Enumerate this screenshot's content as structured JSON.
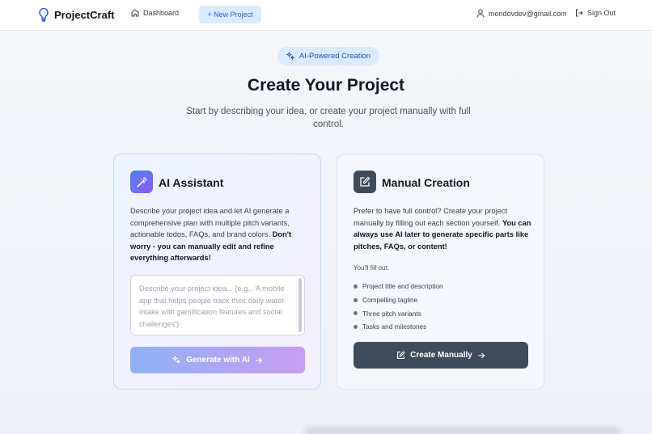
{
  "header": {
    "brand": "ProjectCraft",
    "nav_dashboard": "Dashboard",
    "nav_new_project": "+ New Project",
    "user_email": "mondovdev@gmail.com",
    "sign_out": "Sign Out"
  },
  "hero": {
    "badge": "AI-Powered Creation",
    "title": "Create Your Project",
    "subtitle": "Start by describing your idea, or create your project manually with full control."
  },
  "ai_card": {
    "title": "AI Assistant",
    "desc_plain": "Describe your project idea and let AI generate a comprehensive plan with multiple pitch variants, actionable todos, FAQs, and brand colors. ",
    "desc_bold": "Don't worry - you can manually edit and refine everything afterwards!",
    "textarea_placeholder": "Describe your project idea... (e.g., 'A mobile app that helps people track their daily water intake with gamification features and social challenges')",
    "button_label": "Generate with AI",
    "accent_start": "#8fb1f5",
    "accent_end": "#c89df2"
  },
  "manual_card": {
    "title": "Manual Creation",
    "desc_plain": "Prefer to have full control? Create your project manually by filling out each section yourself. ",
    "desc_bold": "You can always use AI later to generate specific parts like pitches, FAQs, or content!",
    "fill_label": "You'll fill out:",
    "fill_items": [
      "Project title and description",
      "Compelling tagline",
      "Three pitch variants",
      "Tasks and milestones"
    ],
    "button_label": "Create Manually",
    "button_color": "#3f4a5a"
  },
  "icons": {
    "brand": "lightbulb-icon",
    "dashboard": "home-icon",
    "user": "user-icon",
    "sign_out": "sign-out-icon",
    "badge": "sparkles-icon",
    "ai": "magic-wand-icon",
    "manual": "edit-icon",
    "arrow": "arrow-right-icon"
  }
}
